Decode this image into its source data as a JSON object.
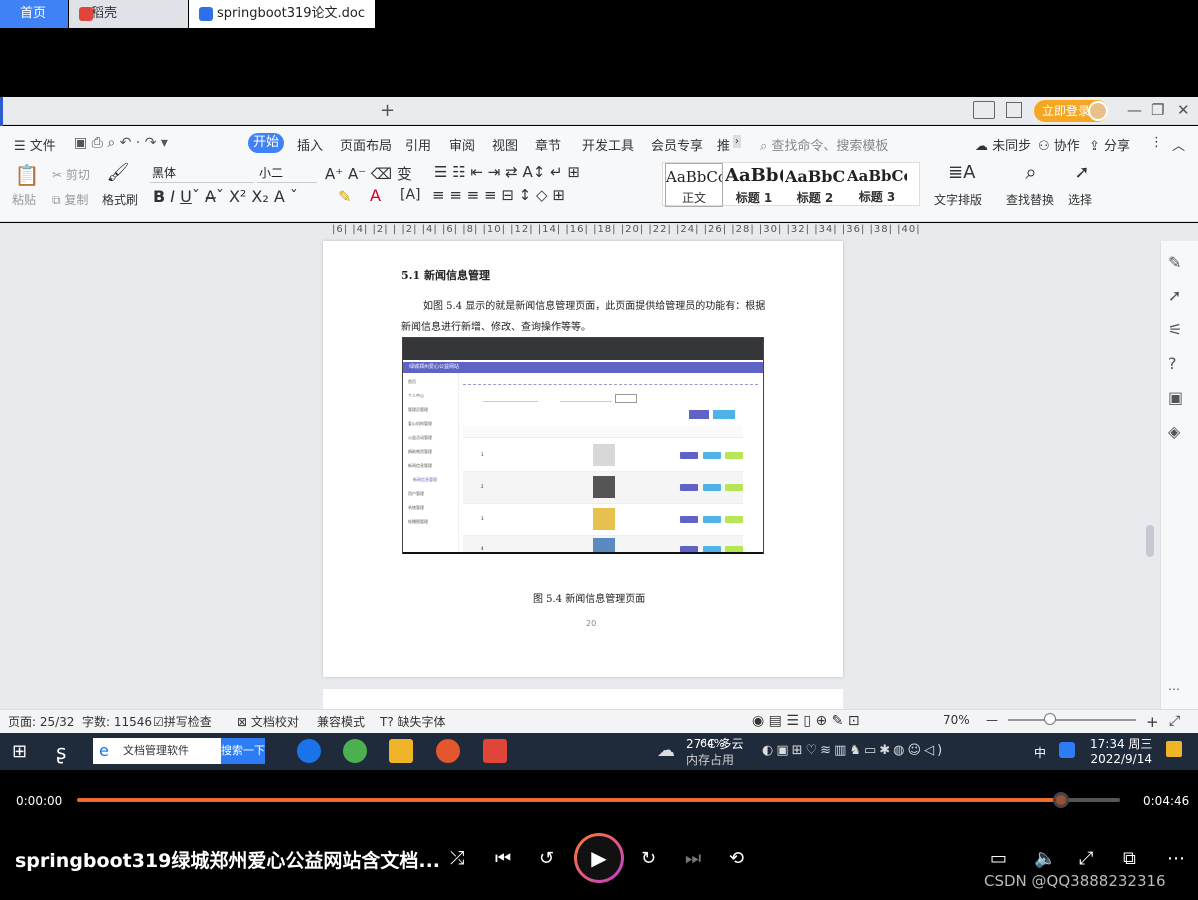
{
  "tabs": {
    "home": "首页",
    "daoke": "稻壳",
    "doc": "springboot319论文.doc"
  },
  "header": {
    "login": "立即登录"
  },
  "menu": {
    "file": "文件",
    "items": [
      "开始",
      "插入",
      "页面布局",
      "引用",
      "审阅",
      "视图",
      "章节",
      "开发工具",
      "会员专享",
      "推"
    ],
    "search_placeholder": "查找命令、搜索模板",
    "sync": "未同步",
    "collab": "协作",
    "share": "分享"
  },
  "toolbar": {
    "paste": "粘贴",
    "cut": "剪切",
    "copy": "复制",
    "format_painter": "格式刷",
    "font_name": "黑体",
    "font_size": "小二",
    "styles": [
      {
        "preview": "AaBbCcI",
        "label": "正文"
      },
      {
        "preview": "AaBb(",
        "label": "标题 1"
      },
      {
        "preview": "AaBbC",
        "label": "标题 2"
      },
      {
        "preview": "AaBbCcl",
        "label": "标题 3"
      }
    ],
    "text_layout": "文字排版",
    "find_replace": "查找替换",
    "select": "选择"
  },
  "ruler": "|6| |4| |2| |  |2| |4| |6| |8| |10| |12| |14| |16| |18| |20| |22| |24| |26| |28| |30| |32| |34| |36| |38| |40|",
  "document": {
    "heading": "5.1 新闻信息管理",
    "paragraph": "如图 5.4 显示的就是新闻信息管理页面，此页面提供给管理员的功能有：根据新闻信息进行新增、修改、查询操作等等。",
    "caption": "图 5.4  新闻信息管理页面",
    "page_number": "20",
    "embedded": {
      "site_title": "绿城郑州爱心公益网站",
      "sidebar": [
        "首页",
        "个人中心",
        "管理员管理",
        "爱心机构管理",
        "公益活动管理",
        "捐助物资管理",
        "新闻信息管理",
        "新闻信息管理",
        "用户管理",
        "系统管理",
        "轮播图管理"
      ],
      "rows": [
        "1",
        "2",
        "3",
        "4"
      ]
    }
  },
  "status": {
    "page": "页面: 25/32",
    "words": "字数: 11546",
    "spellcheck": "拼写检查",
    "proofread": "文档校对",
    "compat": "兼容模式",
    "missing_font": "缺失字体",
    "zoom": "70%"
  },
  "taskbar": {
    "search_text": "文档管理软件",
    "search_btn": "搜索一下",
    "weather": "27°C 多云",
    "memory_pct": "64%",
    "memory_label": "内存占用",
    "ime": "中",
    "time": "17:34 周三",
    "date": "2022/9/14"
  },
  "player": {
    "current": "0:00:00",
    "total": "0:04:46",
    "progress": 0.943,
    "title": "springboot319绿城郑州爱心公益网站含文档...",
    "watermark": "CSDN @QQ3888232316"
  }
}
